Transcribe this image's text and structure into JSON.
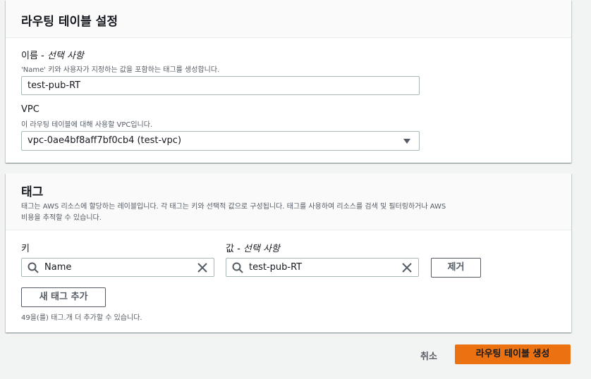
{
  "route_table_settings": {
    "title": "라우팅 테이블 설정",
    "name_label": "이름",
    "name_optional": " - 선택 사항",
    "name_description": "'Name' 키와 사용자가 지정하는 값을 포함하는 태그를 생성합니다.",
    "name_value": "test-pub-RT",
    "vpc_label": "VPC",
    "vpc_description": "이 라우팅 테이블에 대해 사용할 VPC입니다.",
    "vpc_selected": "vpc-0ae4bf8aff7bf0cb4 (test-vpc)"
  },
  "tags": {
    "title": "태그",
    "description_line1": "태그는 AWS 리소스에 할당하는 레이블입니다. 각 태그는 키와 선택적 값으로 구성됩니다. 태그를 사용하여 리소스를 검색 및 필터링하거나 AWS",
    "description_line2": "비용을 추적할 수 있습니다.",
    "key_label": "키",
    "value_label": "값",
    "value_optional": " - 선택 사항",
    "rows": [
      {
        "key": "Name",
        "value": "test-pub-RT",
        "remove_label": "제거"
      }
    ],
    "add_tag_label": "새 태그 추가",
    "remaining_text": "49을(를) 태그.개 더 추가할 수 있습니다."
  },
  "footer": {
    "cancel_label": "취소",
    "create_label": "라우팅 테이블 생성"
  },
  "colors": {
    "accent": "#ec7211",
    "background": "#f2f3f3"
  }
}
